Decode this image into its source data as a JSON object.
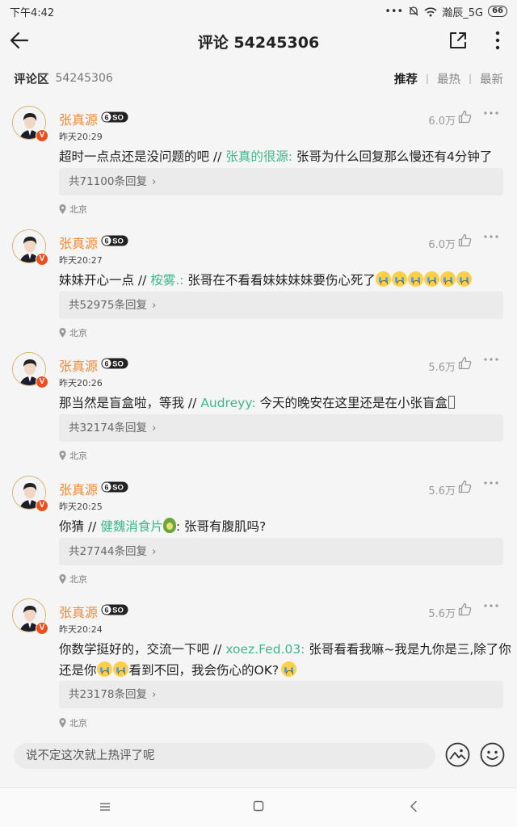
{
  "status_bar": {
    "time": "下午4:42",
    "carrier": "瀚辰_5G",
    "battery": "66"
  },
  "nav": {
    "title": "评论 54245306"
  },
  "section": {
    "label": "评论区",
    "count": "54245306",
    "tabs": [
      "推荐",
      "最热",
      "最新"
    ],
    "active_tab": "推荐"
  },
  "comments": [
    {
      "name": "张真源",
      "time": "昨天20:29",
      "likes": "6.0万",
      "text_before": "超时一点点还是没问题的吧 // ",
      "mention": "张真的很源:",
      "text_after": " 张哥为什么回复那么慢还有4分钟了",
      "text_extra": "",
      "replies": "共71100条回复",
      "location": "北京"
    },
    {
      "name": "张真源",
      "time": "昨天20:27",
      "likes": "6.0万",
      "text_before": "妹妹开心一点 // ",
      "mention": "桉雾.:",
      "text_after": " 张哥在不看看妹妹妹妹要伤心死了",
      "text_extra": "",
      "replies": "共52975条回复",
      "location": "北京"
    },
    {
      "name": "张真源",
      "time": "昨天20:26",
      "likes": "5.6万",
      "text_before": "那当然是盲盒啦，等我 // ",
      "mention": "Audreyy:",
      "text_after": " 今天的晚安在这里还是在小张盲盒",
      "text_extra": "",
      "replies": "共32174条回复",
      "location": "北京"
    },
    {
      "name": "张真源",
      "time": "昨天20:25",
      "likes": "5.6万",
      "text_before": "你猜 // ",
      "mention": "健魏消食片",
      "text_after": ": 张哥有腹肌吗?",
      "text_extra": "",
      "replies": "共27744条回复",
      "location": "北京"
    },
    {
      "name": "张真源",
      "time": "昨天20:24",
      "likes": "5.6万",
      "text_before": "你数学挺好的，交流一下吧 // ",
      "mention": "xoez.Fed.03:",
      "text_after": " 张哥看看我嘛~我是九你是三,除了你还是你",
      "text_extra": "看到不回，我会伤心的OK?",
      "replies": "共23178条回复",
      "location": "北京"
    }
  ],
  "input": {
    "placeholder": "说不定这次就上热评了呢"
  },
  "icons": {
    "back": "arrow-left-icon",
    "share": "share-icon",
    "more": "more-vertical-icon",
    "like": "thumbs-up-icon",
    "comment_more": "more-horizontal-icon",
    "location": "location-pin-icon",
    "image": "image-icon",
    "emoji": "smiley-icon"
  },
  "colors": {
    "name": "#f08a3a",
    "mention": "#3cb88c",
    "verify": "#f04d1c",
    "background": "#f5f5f5"
  }
}
